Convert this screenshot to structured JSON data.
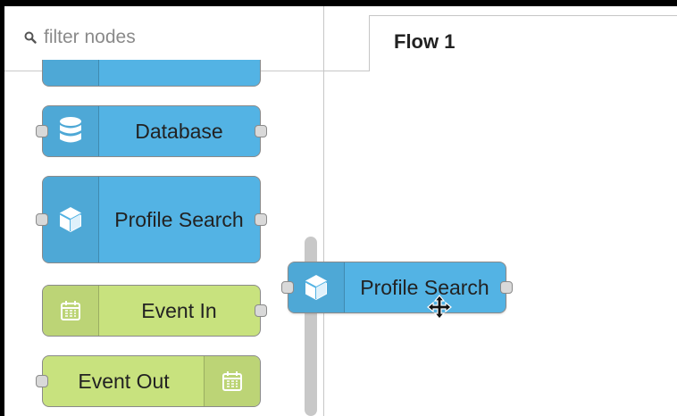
{
  "palette": {
    "filter_placeholder": "filter nodes",
    "nodes": [
      {
        "label": "Database",
        "icon": "database-icon",
        "color": "#53b3e4"
      },
      {
        "label": "Profile Search",
        "icon": "cube-icon",
        "color": "#53b3e4"
      },
      {
        "label": "Event In",
        "icon": "calendar-icon",
        "color": "#c8e27e"
      },
      {
        "label": "Event Out",
        "icon": "calendar-icon",
        "color": "#c8e27e"
      }
    ]
  },
  "workspace": {
    "tabs": [
      {
        "label": "Flow 1",
        "active": true
      }
    ],
    "dragged_node": {
      "label": "Profile Search",
      "icon": "cube-icon"
    }
  },
  "colors": {
    "blue_node": "#53b3e4",
    "green_node": "#c8e27e"
  }
}
